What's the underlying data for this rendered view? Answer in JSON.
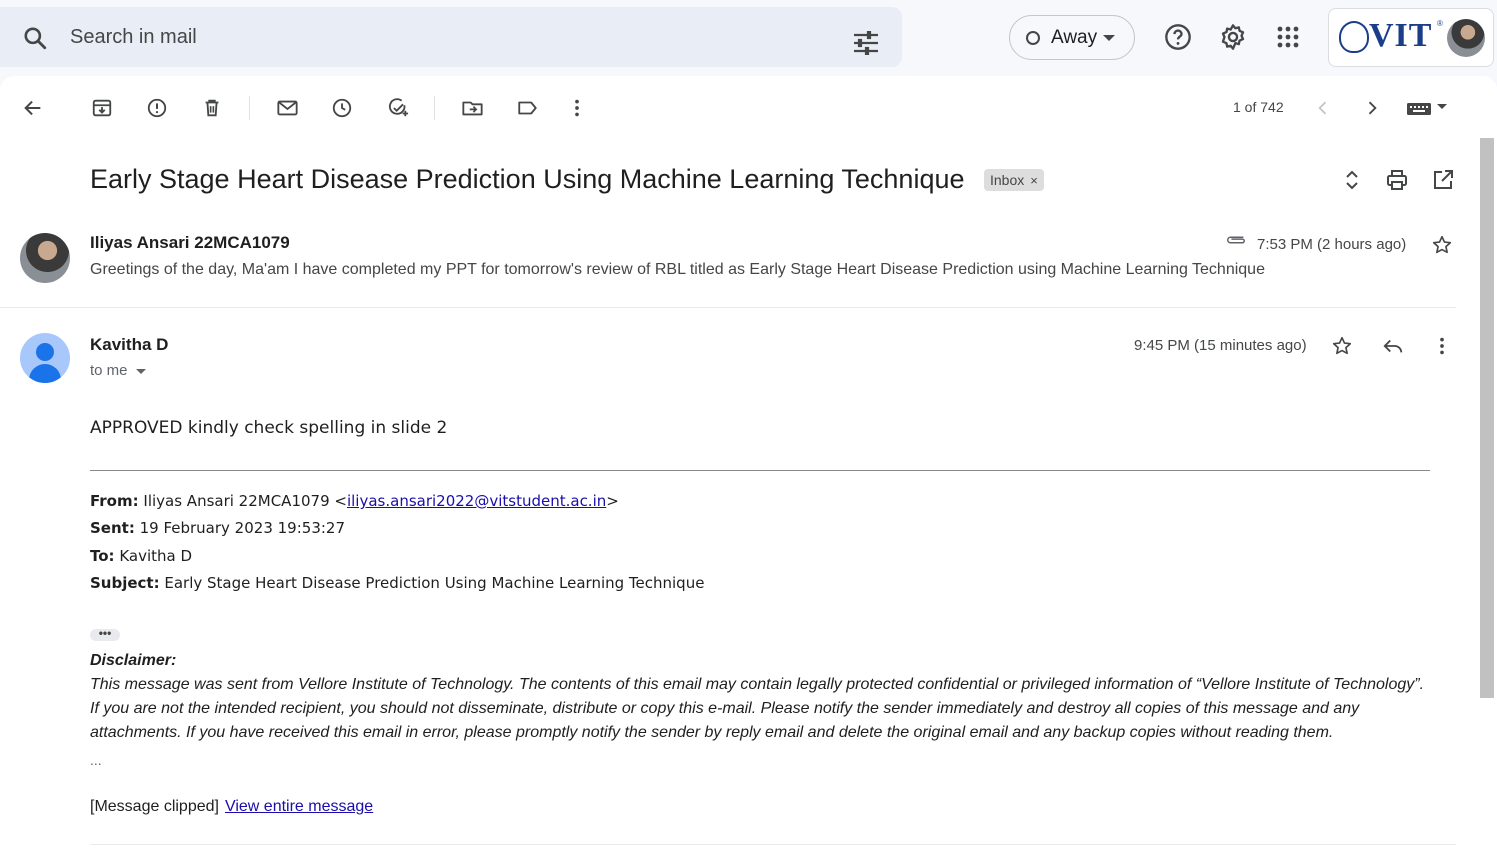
{
  "search": {
    "placeholder": "Search in mail"
  },
  "status": {
    "label": "Away"
  },
  "account": {
    "logo_text": "VIT",
    "logo_mark": "®"
  },
  "pager": {
    "text": "1 of 742"
  },
  "thread": {
    "subject": "Early Stage Heart Disease Prediction Using Machine Learning Technique",
    "label": "Inbox",
    "label_close": "×"
  },
  "messages": [
    {
      "sender": "Iliyas Ansari 22MCA1079",
      "time": "7:53 PM (2 hours ago)",
      "snippet": "Greetings of the day, Ma'am I have completed my PPT for tomorrow's review of RBL titled as Early Stage Heart Disease Prediction using Machine Learning Technique"
    },
    {
      "sender": "Kavitha D",
      "to": "to me",
      "time": "9:45 PM (15 minutes ago)",
      "body": "APPROVED kindly check spelling in slide 2",
      "quoted": {
        "from_label": "From:",
        "from_name": " Iliyas Ansari 22MCA1079 <",
        "from_email": "iliyas.ansari2022@vitstudent.ac.in",
        "from_end": ">",
        "sent_label": "Sent:",
        "sent": " 19 February 2023 19:53:27",
        "to_label": "To:",
        "to": " Kavitha D",
        "subject_label": "Subject:",
        "subject": " Early Stage Heart Disease Prediction Using Machine Learning Technique"
      },
      "show_trimmed": "•••",
      "disclaimer_title": "Disclaimer:",
      "disclaimer_lines": [
        "This message was sent from Vellore Institute of Technology.  The contents of this email may contain legally protected confidential or privileged information of “Vellore Institute of Technology”.",
        "If you are not the intended recipient, you should not disseminate, distribute or copy this e-mail. Please notify the sender immediately and destroy all copies of this message and any",
        "attachments. If you have received this email in error, please promptly notify the sender by reply email and delete the original email and any backup copies without reading them."
      ],
      "ellipsis": "...",
      "clipped_text": "[Message clipped]",
      "view_entire": "View entire message"
    }
  ],
  "colors": {
    "search_bg": "#e9eef6",
    "page_bg": "#f6f8fc",
    "link": "#1a0dab",
    "avatar_blue": "#1a73e8"
  }
}
